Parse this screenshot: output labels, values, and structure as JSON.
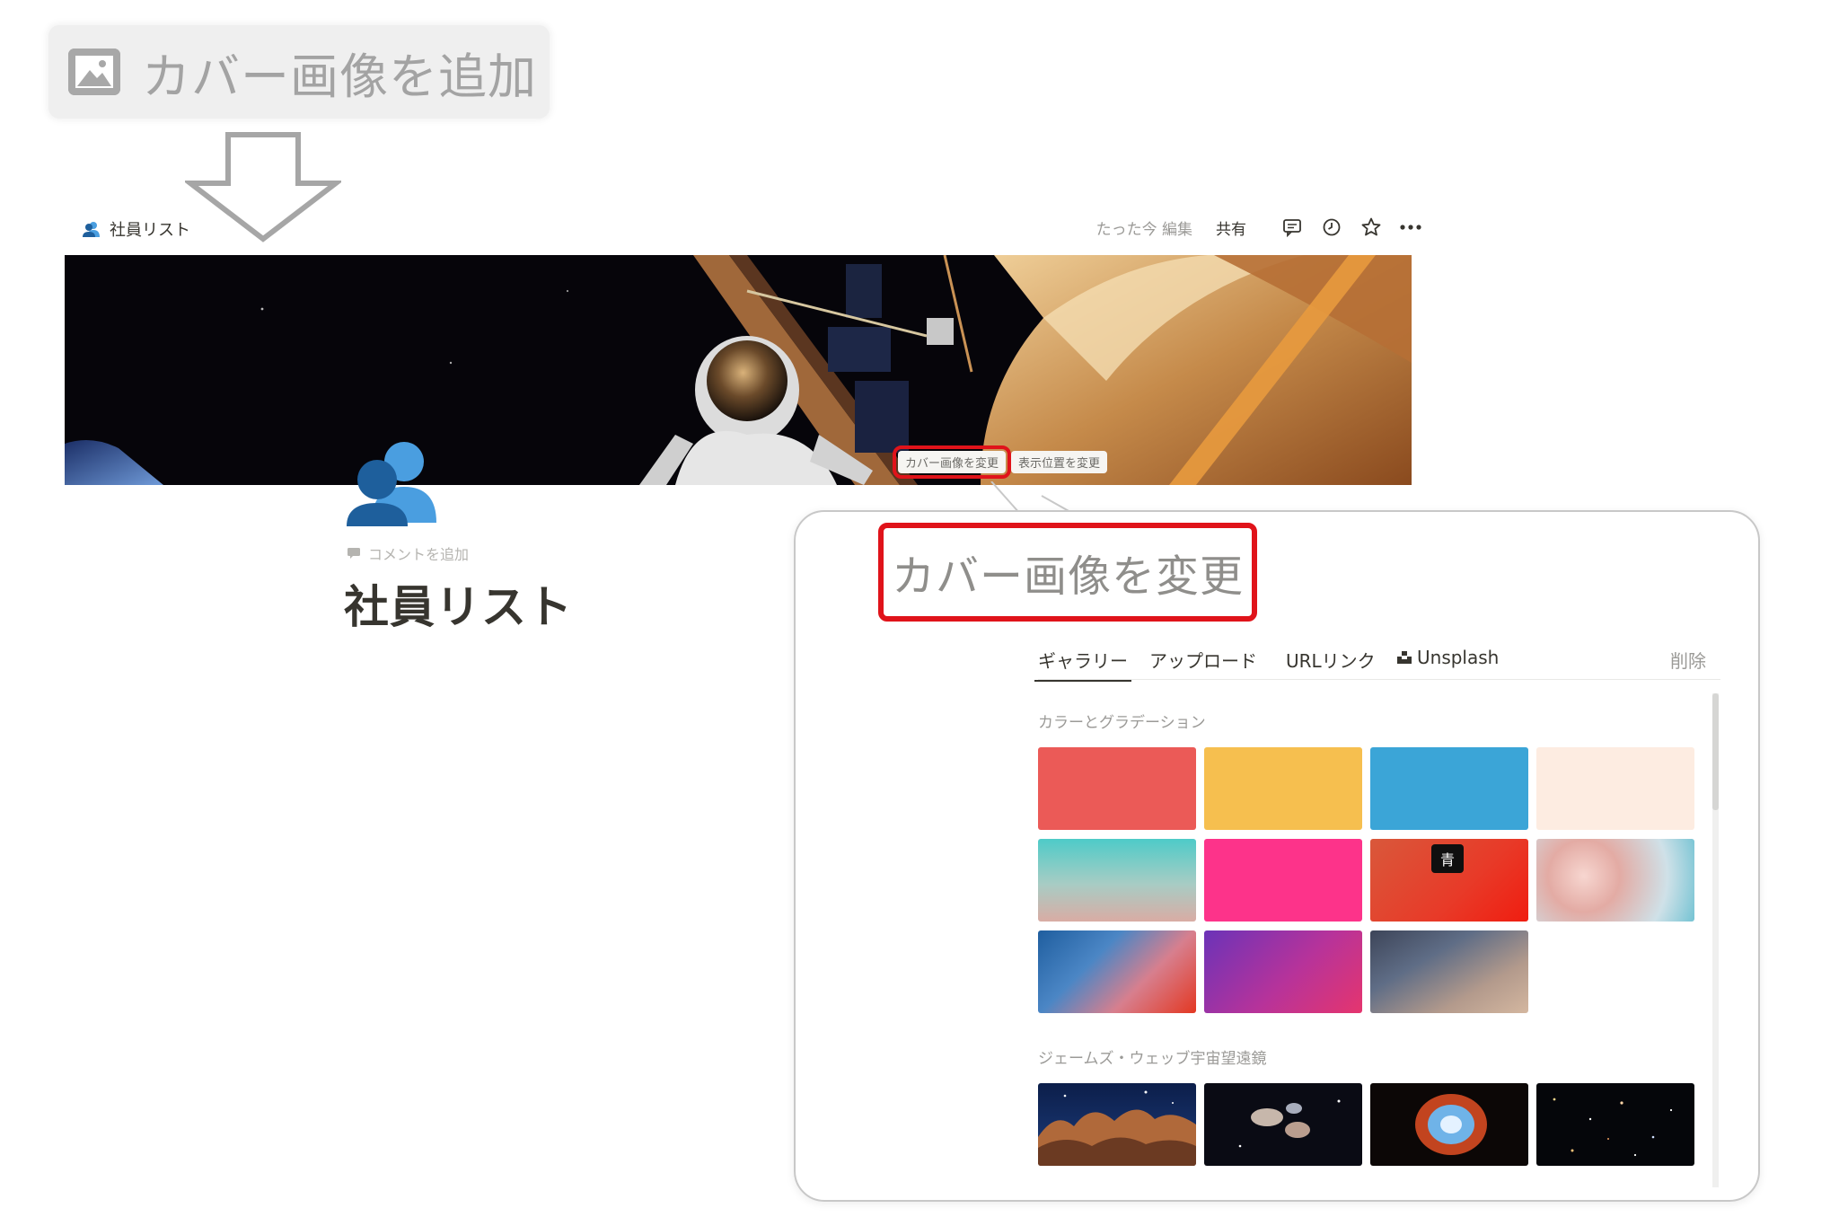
{
  "callout_button": {
    "label": "カバー画像を追加"
  },
  "topbar": {
    "breadcrumb": "社員リスト",
    "edited": "たった今 編集",
    "share": "共有"
  },
  "cover_buttons": {
    "change_cover": "カバー画像を変更",
    "reposition": "表示位置を変更"
  },
  "page": {
    "add_comment": "コメントを追加",
    "title": "社員リスト"
  },
  "popup": {
    "title": "カバー画像を変更",
    "tabs": {
      "gallery": "ギャラリー",
      "upload": "アップロード",
      "link": "URLリンク",
      "unsplash": "Unsplash",
      "remove": "削除"
    },
    "sections": {
      "colors": "カラーとグラデーション",
      "webb": "ジェームズ・ウェッブ宇宙望遠鏡"
    },
    "tooltip": "青"
  },
  "colors": {
    "accent_red": "#e0131a",
    "swatches": [
      {
        "name": "red",
        "bg": "#eb5a57"
      },
      {
        "name": "yellow",
        "bg": "#f6bf4f"
      },
      {
        "name": "blue",
        "bg": "#3ba5d7"
      },
      {
        "name": "beige",
        "bg": "#fdece1"
      },
      {
        "name": "gradient-teal",
        "bg": "linear-gradient(180deg,#4ecbc8 0%,#a8ccc4 55%,#d9aca4 100%)"
      },
      {
        "name": "pink",
        "bg": "#fd338a"
      },
      {
        "name": "gradient-red",
        "bg": "linear-gradient(135deg,#d9583b 0%,#e83a28 60%,#f01d10 100%)"
      },
      {
        "name": "gradient-peach-ice",
        "bg": "radial-gradient(circle at 30% 45%,#f7d6d0 0%,#e3aba4 30%,#cfe1e8 70%,#74c3d3 100%)"
      },
      {
        "name": "gradient-blue-red",
        "bg": "linear-gradient(135deg,#1f5e9f 0%,#4b86c5 35%,#d77f8e 65%,#e33822 100%)"
      },
      {
        "name": "gradient-purple",
        "bg": "linear-gradient(135deg,#6b33b8 0%,#b7339a 55%,#e5356e 100%)"
      },
      {
        "name": "gradient-navy-sand",
        "bg": "linear-gradient(150deg,#3d4559 0%,#5f6d86 35%,#b39a8c 70%,#d4b7a0 100%)"
      }
    ]
  }
}
